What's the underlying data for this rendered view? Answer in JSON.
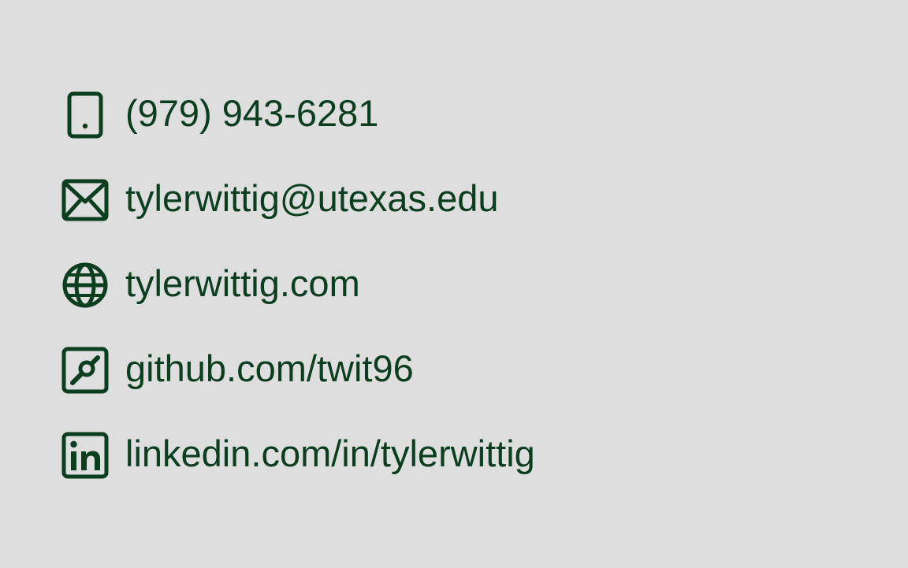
{
  "colors": {
    "background": "#dedede",
    "accent": "#0b3d1f"
  },
  "contacts": [
    {
      "icon": "phone-icon",
      "text": "(979) 943-6281"
    },
    {
      "icon": "email-icon",
      "text": "tylerwittig@utexas.edu"
    },
    {
      "icon": "globe-icon",
      "text": "tylerwittig.com"
    },
    {
      "icon": "github-icon",
      "text": "github.com/twit96"
    },
    {
      "icon": "linkedin-icon",
      "text": "linkedin.com/in/tylerwittig"
    }
  ]
}
